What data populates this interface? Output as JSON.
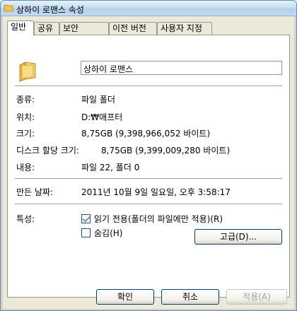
{
  "window": {
    "title": "상하이 로맨스 속성"
  },
  "tabs": [
    {
      "label": "일반"
    },
    {
      "label": "공유"
    },
    {
      "label": "보안"
    },
    {
      "label": "이전 버전"
    },
    {
      "label": "사용자 지정"
    }
  ],
  "general": {
    "name_value": "상하이 로맨스",
    "type_label": "종류:",
    "type_value": "파일 폴더",
    "location_label": "위치:",
    "location_value": "D:₩애프터",
    "size_label": "크기:",
    "size_value": "8,75GB (9,398,966,052 바이트)",
    "disk_size_label": "디스크 할당 크기:",
    "disk_size_value": "8,75GB (9,399,009,280 바이트)",
    "contents_label": "내용:",
    "contents_value": "파일 22, 폴더 0",
    "created_label": "만든 날짜:",
    "created_value": "2011년 10월 9일 일요일, 오후 3:58:17",
    "attributes_label": "특성:",
    "readonly_label": "읽기 전용(폴더의 파일에만 적용)(R)",
    "hidden_label": "숨김(H)",
    "advanced_button": "고급(D)..."
  },
  "footer": {
    "ok": "확인",
    "cancel": "취소",
    "apply": "적용(A)"
  },
  "colors": {
    "folder": "#f0c44c",
    "title_gradient": "#c9deef"
  }
}
